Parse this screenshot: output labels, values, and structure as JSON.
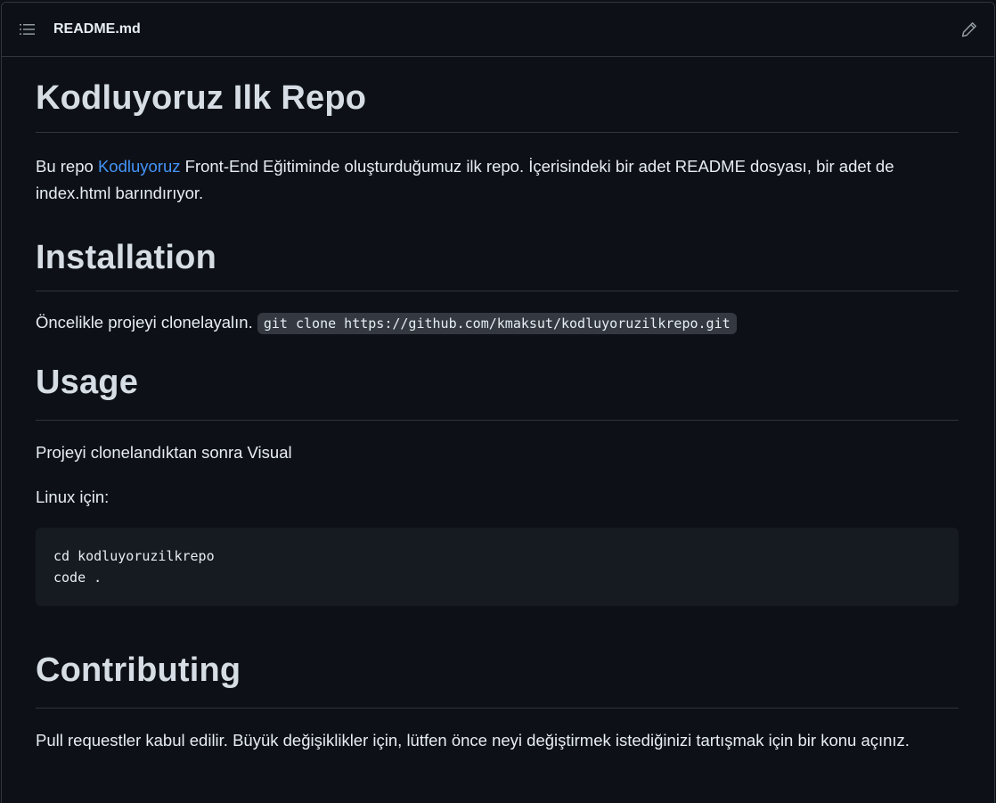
{
  "header": {
    "file_name": "README.md",
    "outline_icon": "list-unordered-icon",
    "edit_icon": "pencil-icon"
  },
  "content": {
    "title": "Kodluyoruz Ilk Repo",
    "intro": {
      "prefix": "Bu repo ",
      "link": "Kodluyoruz",
      "suffix": " Front-End Eğitiminde oluşturduğumuz ilk repo. İçerisindeki bir adet README dosyası, bir adet de index.html barındırıyor."
    },
    "installation": {
      "heading": "Installation",
      "text": "Öncelikle projeyi clonelayalın. ",
      "code": "git clone https://github.com/kmaksut/kodluyoruzilkrepo.git"
    },
    "usage": {
      "heading": "Usage",
      "text1": "Projeyi clonelandıktan sonra Visual",
      "text2": "Linux için:",
      "code": "cd kodluyoruzilkrepo\ncode ."
    },
    "contributing": {
      "heading": "Contributing",
      "text": "Pull requestler kabul edilir. Büyük değişiklikler için, lütfen önce neyi değiştirmek istediğinizi tartışmak için bir konu açınız."
    }
  },
  "colors": {
    "background": "#0d1117",
    "border": "#30363d",
    "link": "#4493f8",
    "code_bg": "#161b22"
  }
}
